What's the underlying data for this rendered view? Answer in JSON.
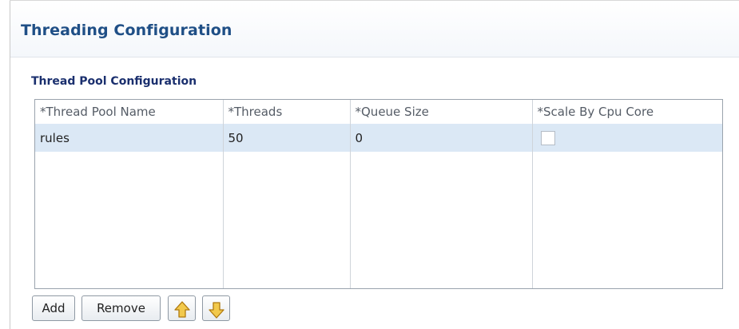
{
  "page": {
    "title": "Threading Configuration"
  },
  "section": {
    "title": "Thread Pool Configuration"
  },
  "table": {
    "columns": [
      "*Thread Pool Name",
      "*Threads",
      "*Queue Size",
      "*Scale By Cpu Core"
    ],
    "rows": [
      {
        "name": "rules",
        "threads": "50",
        "queue_size": "0",
        "scale_by_cpu_core": false
      }
    ]
  },
  "buttons": {
    "add_label": "Add",
    "remove_label": "Remove",
    "move_up_icon": "arrow-up-icon",
    "move_down_icon": "arrow-down-icon"
  },
  "colors": {
    "title": "#1f4f86",
    "section_title": "#1a2f6e",
    "selected_row": "#dbe8f5",
    "arrow_fill": "#f2c94c",
    "arrow_stroke": "#b07a10"
  }
}
